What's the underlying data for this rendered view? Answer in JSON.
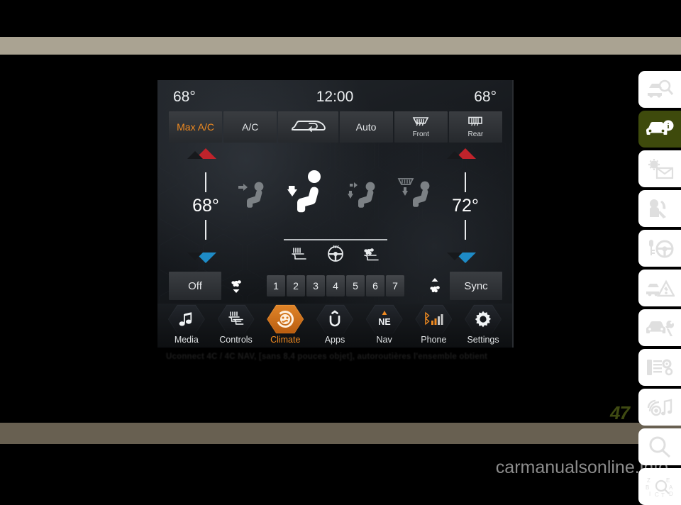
{
  "document": {
    "page_number": "47",
    "footer_site": "carmanualsonline.info",
    "caption": "Uconnect 4C / 4C NAV, [sans 8,4 pouces objet], autoroutières l'ensemble obtient"
  },
  "colors": {
    "band_top": "#aaa392",
    "band_bottom": "#686051",
    "accent_orange": "#ef8a21",
    "hot_red": "#c0232b",
    "cold_blue": "#1e8bc6",
    "tab_active_green": "#3e4a0c",
    "page_number": "#3f4a12"
  },
  "sidebar": {
    "items": [
      {
        "icon": "vehicle-search-icon",
        "active": false
      },
      {
        "icon": "vehicle-info-icon",
        "active": true
      },
      {
        "icon": "lighting-mail-icon",
        "active": false
      },
      {
        "icon": "seatbelt-safety-icon",
        "active": false
      },
      {
        "icon": "key-steering-wheel-icon",
        "active": false
      },
      {
        "icon": "vehicle-warning-icon",
        "active": false
      },
      {
        "icon": "vehicle-service-icon",
        "active": false
      },
      {
        "icon": "specifications-gears-icon",
        "active": false
      },
      {
        "icon": "multimedia-icon",
        "active": false
      },
      {
        "icon": "search-magnifier-icon",
        "active": false
      },
      {
        "icon": "index-abc-icon",
        "active": false
      }
    ]
  },
  "screen": {
    "status": {
      "left_temp": "68°",
      "clock": "12:00",
      "right_temp": "68°"
    },
    "top_buttons": [
      {
        "label": "Max A/C",
        "icon": "",
        "sub": "",
        "accent": true
      },
      {
        "label": "A/C",
        "icon": "",
        "sub": "",
        "accent": false
      },
      {
        "label": "",
        "icon": "recirculation-icon",
        "sub": "",
        "accent": false
      },
      {
        "label": "Auto",
        "icon": "",
        "sub": "",
        "accent": false
      },
      {
        "label": "",
        "icon": "front-defrost-icon",
        "sub": "Front",
        "accent": false
      },
      {
        "label": "",
        "icon": "rear-defrost-icon",
        "sub": "Rear",
        "accent": false
      }
    ],
    "temperature": {
      "driver": {
        "value": "68°",
        "up_icon": "increase-temp-triangle",
        "down_icon": "decrease-temp-triangle"
      },
      "passenger": {
        "value": "72°",
        "up_icon": "increase-temp-triangle",
        "down_icon": "decrease-temp-triangle"
      }
    },
    "airflow_modes": [
      {
        "icon": "airflow-upper-icon",
        "selected": false
      },
      {
        "icon": "airflow-upper-lower-icon",
        "selected": true
      },
      {
        "icon": "airflow-lower-icon",
        "selected": false
      },
      {
        "icon": "airflow-defrost-lower-icon",
        "selected": false
      }
    ],
    "comfort_icons": [
      {
        "icon": "heated-seat-icon"
      },
      {
        "icon": "heated-steering-wheel-icon"
      },
      {
        "icon": "ventilated-seat-icon"
      }
    ],
    "fan": {
      "off_label": "Off",
      "sync_label": "Sync",
      "decrease_icon": "fan-decrease-icon",
      "increase_icon": "fan-increase-icon",
      "speeds": [
        "1",
        "2",
        "3",
        "4",
        "5",
        "6",
        "7"
      ],
      "selected_speed": null
    },
    "nav_items": [
      {
        "label": "Media",
        "icon": "music-note-icon",
        "active": false
      },
      {
        "label": "Controls",
        "icon": "controls-icon",
        "active": false
      },
      {
        "label": "Climate",
        "icon": "climate-icon",
        "active": true
      },
      {
        "label": "Apps",
        "icon": "uconnect-apps-icon",
        "active": false
      },
      {
        "label": "Nav",
        "icon": "compass-ne-icon",
        "active": false
      },
      {
        "label": "Phone",
        "icon": "phone-bluetooth-signal-icon",
        "active": false
      },
      {
        "label": "Settings",
        "icon": "gear-icon",
        "active": false
      }
    ]
  }
}
